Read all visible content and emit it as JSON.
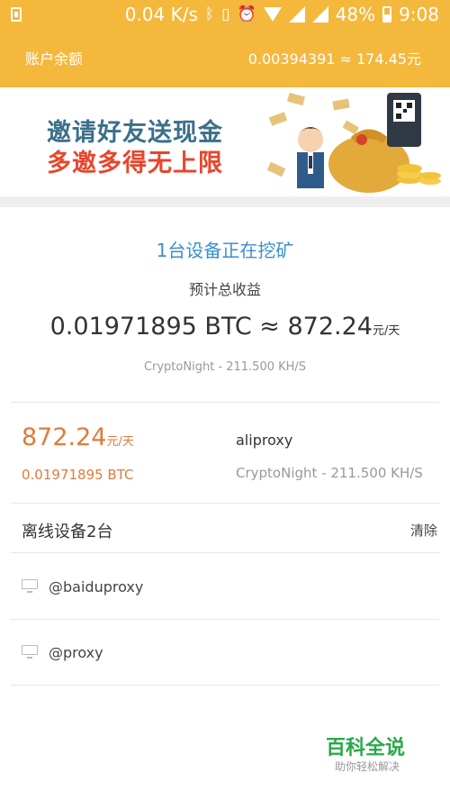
{
  "status_bar": {
    "speed": "0.04 K/s",
    "battery": "48%",
    "time": "9:08",
    "icons": [
      "download-icon",
      "bluetooth-icon",
      "vibrate-icon",
      "alarm-icon",
      "wifi-icon",
      "signal-icon",
      "battery-icon"
    ]
  },
  "header": {
    "title": "账户余额",
    "balance": "0.00394391 ≈ 174.45元"
  },
  "banner": {
    "line1": "邀请好友送现金",
    "line2": "多邀多得无上限",
    "colors": {
      "line1": "#3b6f8a",
      "line2": "#e8452c"
    }
  },
  "mining": {
    "title": "1台设备正在挖矿",
    "estimate_label": "预计总收益",
    "estimate_btc": "0.01971895 BTC",
    "approx": "≈",
    "estimate_cny": "872.24",
    "per_day": "元/天",
    "algo_rate": "CryptoNight - 211.500 KH/S"
  },
  "device": {
    "earn": "872.24",
    "per_day": "元/天",
    "btc": "0.01971895 BTC",
    "name": "aliproxy",
    "algo_rate": "CryptoNight - 211.500 KH/S"
  },
  "offline": {
    "title": "离线设备2台",
    "clear_label": "清除",
    "items": [
      {
        "name": "@baiduproxy"
      },
      {
        "name": "@proxy"
      }
    ]
  },
  "watermark": {
    "title": "百科全说",
    "subtitle": "助你轻松解决"
  },
  "colors": {
    "accent": "#f4b83c",
    "link_blue": "#3a8fcf",
    "earn_orange": "#e07b3c"
  }
}
